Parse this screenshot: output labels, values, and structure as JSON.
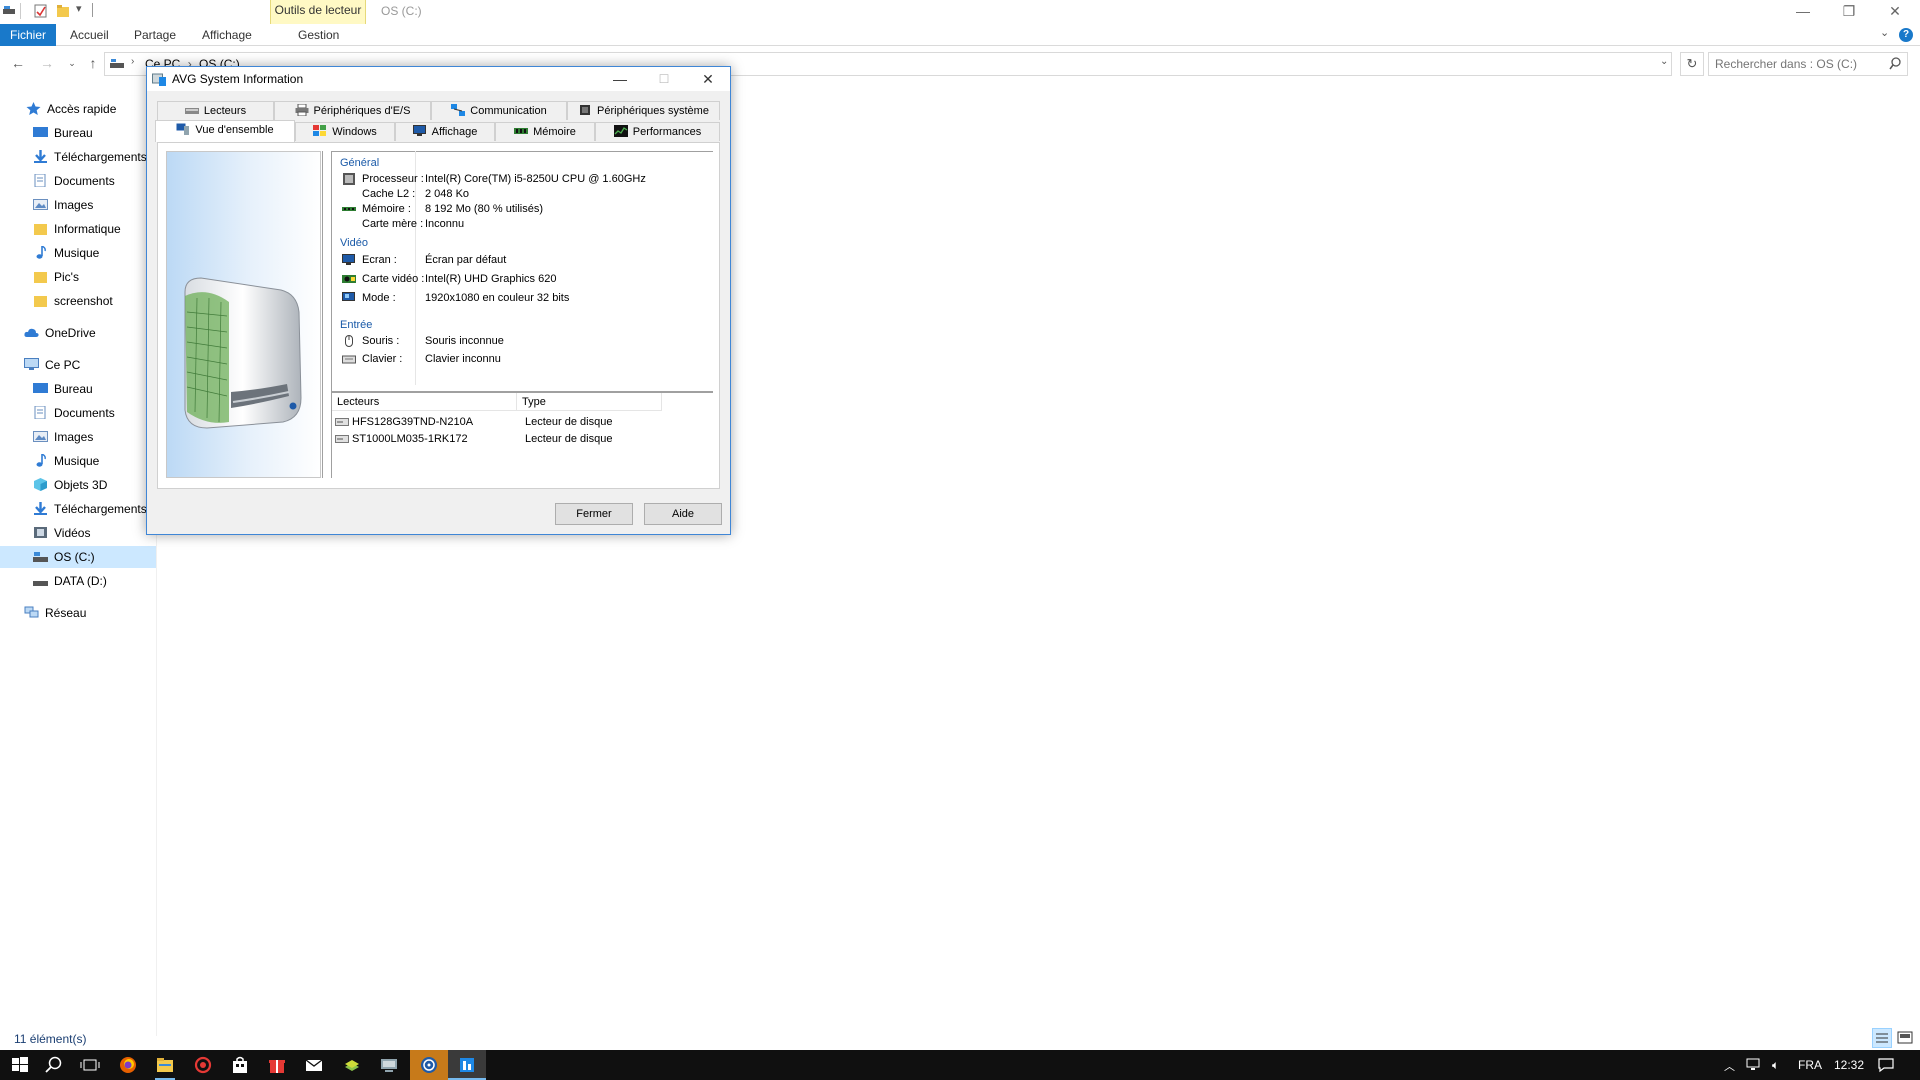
{
  "explorer": {
    "ribbon_context_group": "Outils de lecteur",
    "window_title": "OS (C:)",
    "ribbon_tabs": [
      "Fichier",
      "Accueil",
      "Partage",
      "Affichage",
      "Gestion"
    ],
    "breadcrumb": [
      "Ce PC",
      "OS (C:)"
    ],
    "search_placeholder": "Rechercher dans : OS (C:)",
    "status_text": "11 élément(s)",
    "nav": {
      "quick_access": "Accès rapide",
      "quick_items": [
        "Bureau",
        "Téléchargements",
        "Documents",
        "Images",
        "Informatique",
        "Musique",
        "Pic's",
        "screenshot"
      ],
      "onedrive": "OneDrive",
      "this_pc": "Ce PC",
      "pc_items": [
        "Bureau",
        "Documents",
        "Images",
        "Musique",
        "Objets 3D",
        "Téléchargements",
        "Vidéos",
        "OS (C:)",
        "DATA (D:)"
      ],
      "network": "Réseau"
    }
  },
  "taskbar": {
    "language": "FRA",
    "time": "12:32"
  },
  "dialog": {
    "title": "AVG System Information",
    "tabs_row1": [
      "Lecteurs",
      "Périphériques d'E/S",
      "Communication",
      "Périphériques système"
    ],
    "tabs_row2": [
      "Vue d'ensemble",
      "Windows",
      "Affichage",
      "Mémoire",
      "Performances"
    ],
    "general": {
      "heading": "Général",
      "rows": [
        {
          "label": "Processeur :",
          "value": "Intel(R) Core(TM) i5-8250U CPU @ 1.60GHz"
        },
        {
          "label": "Cache L2 :",
          "value": "2 048 Ko"
        },
        {
          "label": "Mémoire :",
          "value": "8 192 Mo (80 % utilisés)"
        },
        {
          "label": "Carte mère :",
          "value": "Inconnu"
        }
      ]
    },
    "video": {
      "heading": "Vidéo",
      "rows": [
        {
          "label": "Ecran :",
          "value": "Écran par défaut"
        },
        {
          "label": "Carte vidéo :",
          "value": "Intel(R) UHD Graphics 620"
        },
        {
          "label": "Mode :",
          "value": "1920x1080 en couleur 32 bits"
        }
      ]
    },
    "input": {
      "heading": "Entrée",
      "rows": [
        {
          "label": "Souris :",
          "value": "Souris inconnue"
        },
        {
          "label": "Clavier :",
          "value": "Clavier inconnu"
        }
      ]
    },
    "drives": {
      "col_drive": "Lecteurs",
      "col_type": "Type",
      "rows": [
        {
          "name": "HFS128G39TND-N210A",
          "type": "Lecteur de disque"
        },
        {
          "name": "ST1000LM035-1RK172",
          "type": "Lecteur de disque"
        }
      ]
    },
    "buttons": {
      "close": "Fermer",
      "help": "Aide"
    }
  }
}
